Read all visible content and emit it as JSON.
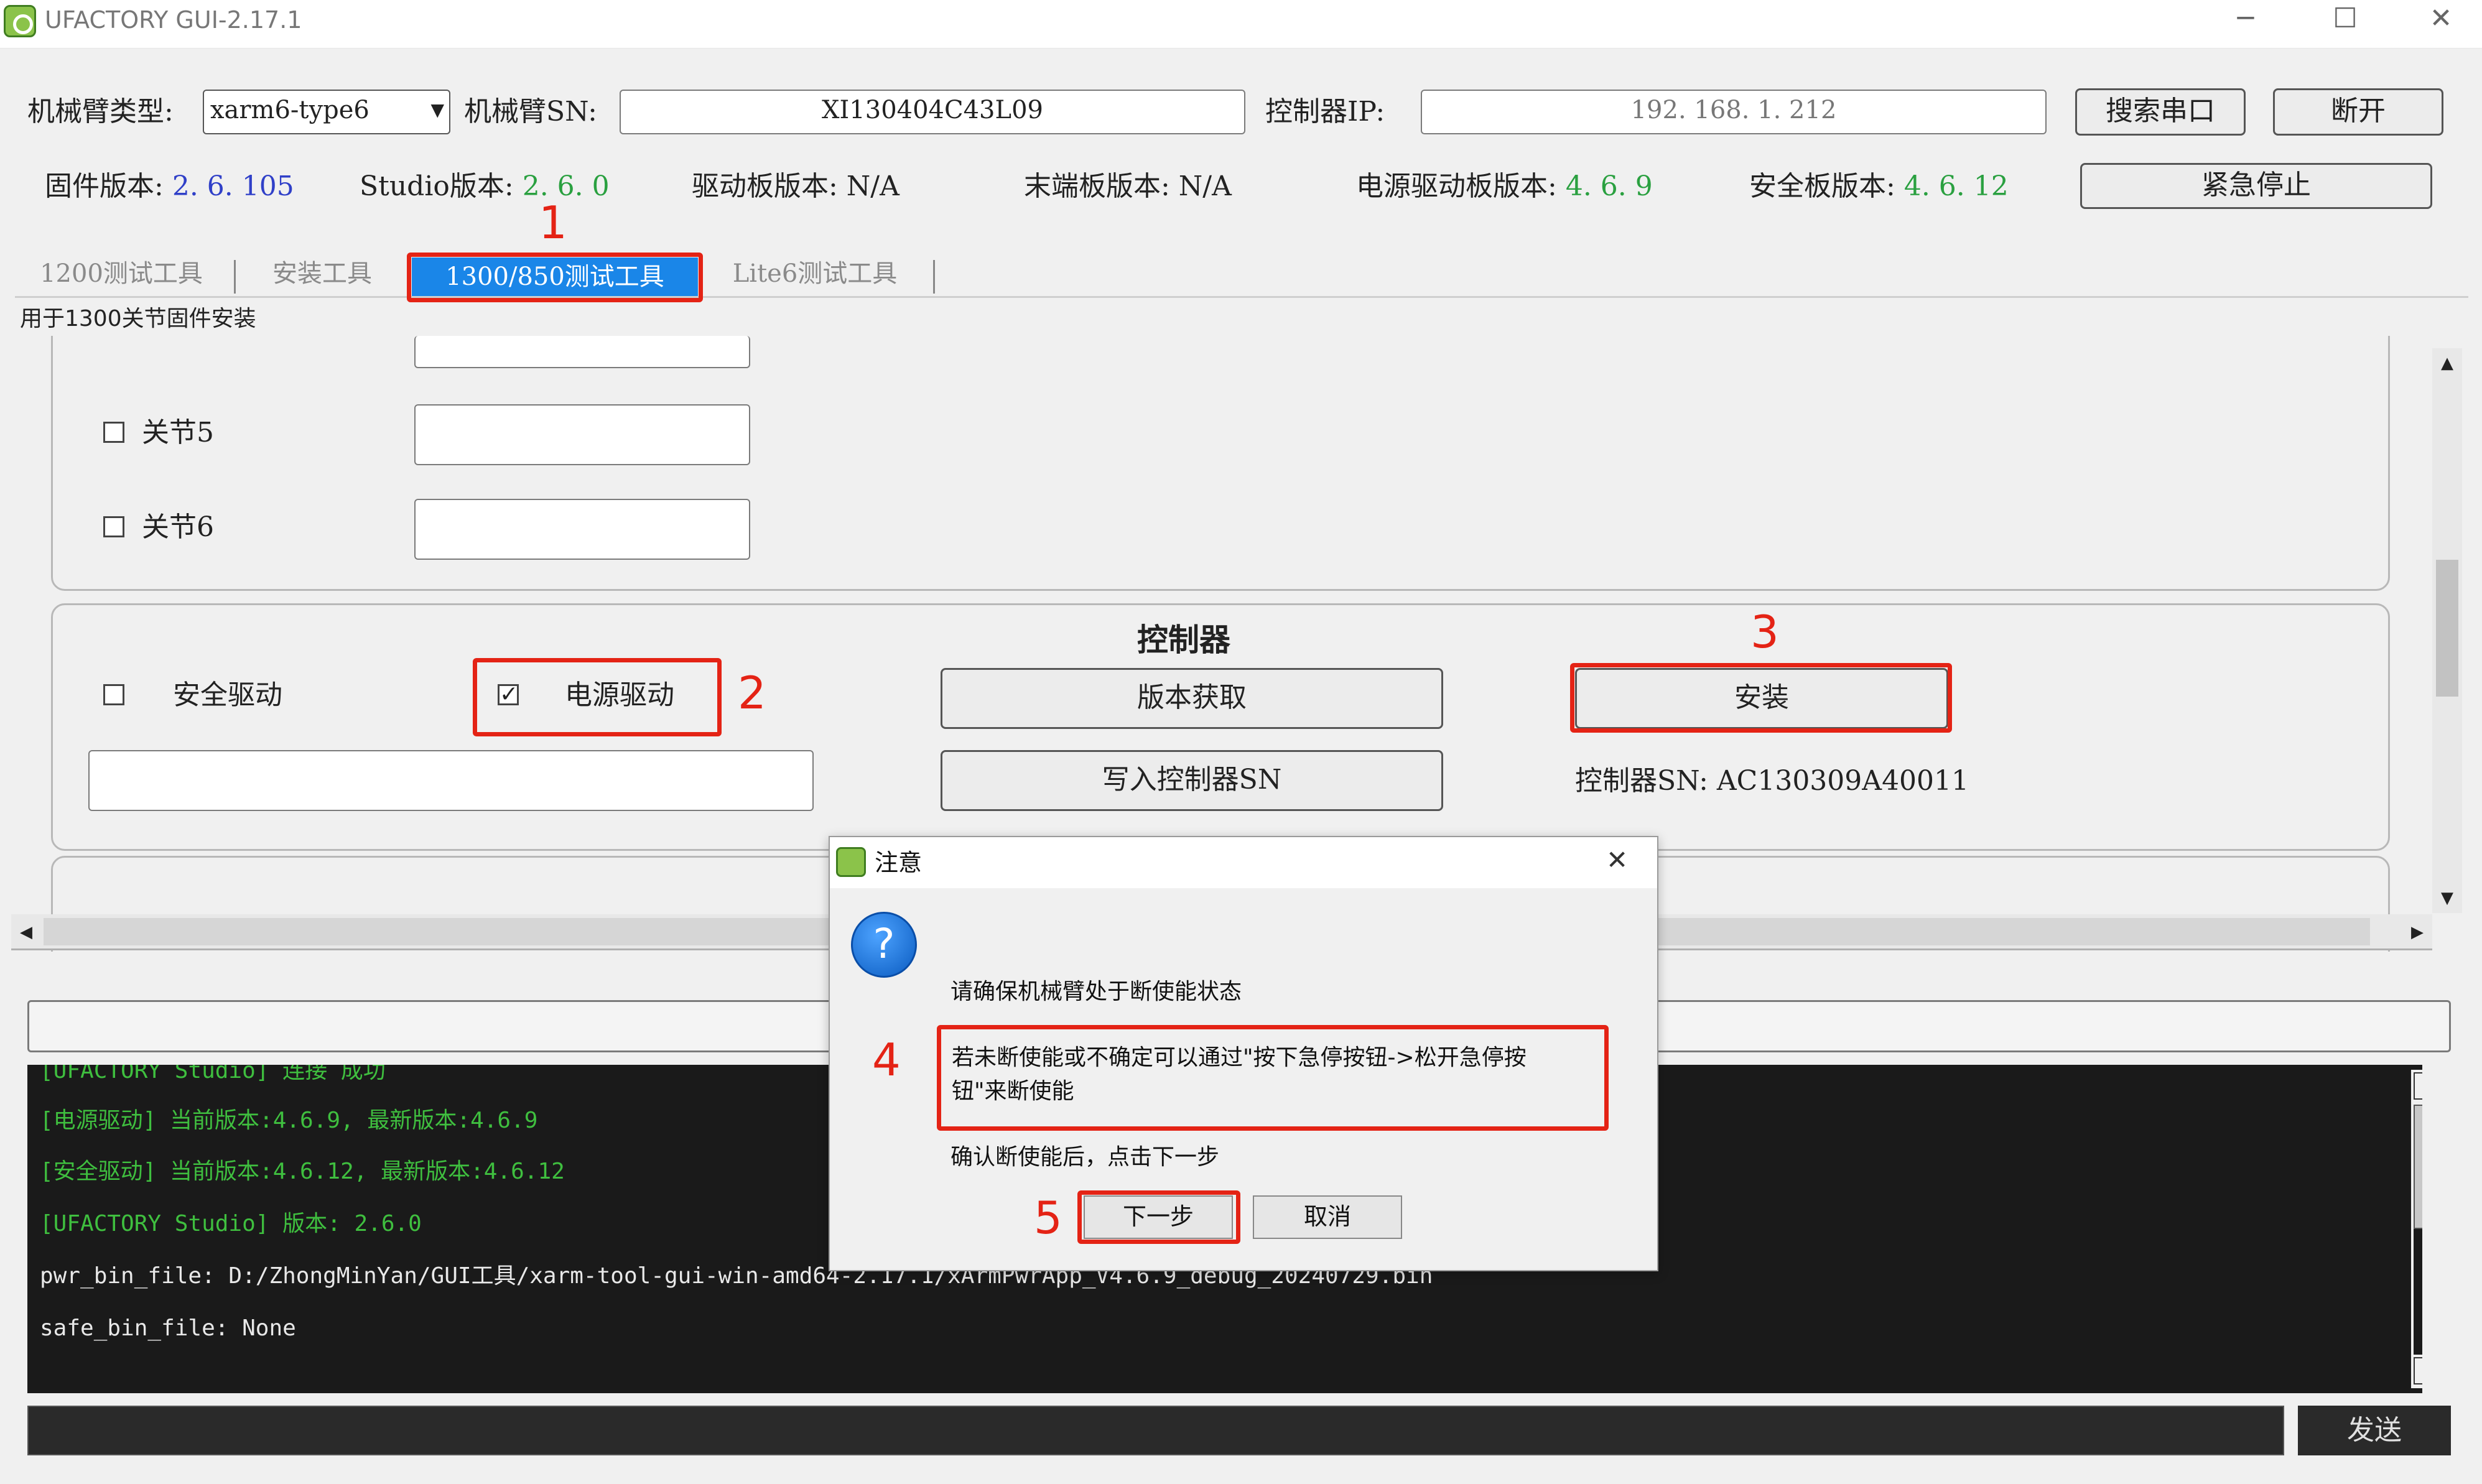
{
  "window": {
    "title": "UFACTORY GUI-2.17.1",
    "minimize": "─",
    "maximize": "☐",
    "close": "✕"
  },
  "connection": {
    "arm_type_label": "机械臂类型:",
    "arm_type_value": "xarm6-type6",
    "arm_sn_label": "机械臂SN:",
    "arm_sn_value": "XI130404C43L09",
    "controller_ip_label": "控制器IP:",
    "controller_ip_value": "192. 168. 1. 212",
    "search_serial_button": "搜索串口",
    "disconnect_button": "断开"
  },
  "versions": {
    "firmware_label": "固件版本:",
    "firmware_value": "2. 6. 105",
    "studio_label": "Studio版本:",
    "studio_value": "2. 6. 0",
    "driver_label": "驱动板版本: N/A",
    "end_label": "末端板版本: N/A",
    "power_label": "电源驱动板版本:",
    "power_value": "4. 6. 9",
    "safety_label": "安全板版本:",
    "safety_value": "4. 6. 12",
    "estop_button": "紧急停止"
  },
  "tabs": [
    {
      "label": "1200测试工具"
    },
    {
      "label": "安装工具"
    },
    {
      "label": "1300/850测试工具"
    },
    {
      "label": "Lite6测试工具"
    }
  ],
  "tab_description": "用于1300关节固件安装",
  "joints": [
    {
      "label": "关节5",
      "value": ""
    },
    {
      "label": "关节6",
      "value": ""
    }
  ],
  "controller": {
    "title": "控制器",
    "safety_drive_label": "安全驱动",
    "power_drive_label": "电源驱动",
    "get_version_button": "版本获取",
    "install_button": "安装",
    "write_sn_button": "写入控制器SN",
    "controller_sn_label": "控制器SN: AC130309A40011"
  },
  "annotations": {
    "n1": "1",
    "n2": "2",
    "n3": "3",
    "n4": "4",
    "n5": "5"
  },
  "log": {
    "lines": [
      {
        "text": "[UFACTORY Studio] 连接 成功",
        "color": "#3fbf3f"
      },
      {
        "text": "[电源驱动] 当前版本:4.6.9, 最新版本:4.6.9",
        "color": "#3fbf3f"
      },
      {
        "text": "[安全驱动] 当前版本:4.6.12, 最新版本:4.6.12",
        "color": "#3fbf3f"
      },
      {
        "text": "[UFACTORY Studio] 版本: 2.6.0",
        "color": "#3fbf3f"
      },
      {
        "text": "pwr_bin_file: D:/ZhongMinYan/GUI工具/xarm-tool-gui-win-amd64-2.17.1/xArmPwrApp_V4.6.9_debug_20240729.bin",
        "color": "#e8e8e8"
      },
      {
        "text": "safe_bin_file: None",
        "color": "#e8e8e8"
      }
    ]
  },
  "command": {
    "value": "",
    "send_button": "发送"
  },
  "dialog": {
    "title": "注意",
    "icon_glyph": "?",
    "close": "✕",
    "line1": "请确保机械臂处于断使能状态",
    "line2a": "若未断使能或不确定可以通过\"按下急停按钮->松开急停按",
    "line2b": "钮\"来断使能",
    "line3": "确认断使能后，点击下一步",
    "next_button": "下一步",
    "cancel_button": "取消"
  }
}
